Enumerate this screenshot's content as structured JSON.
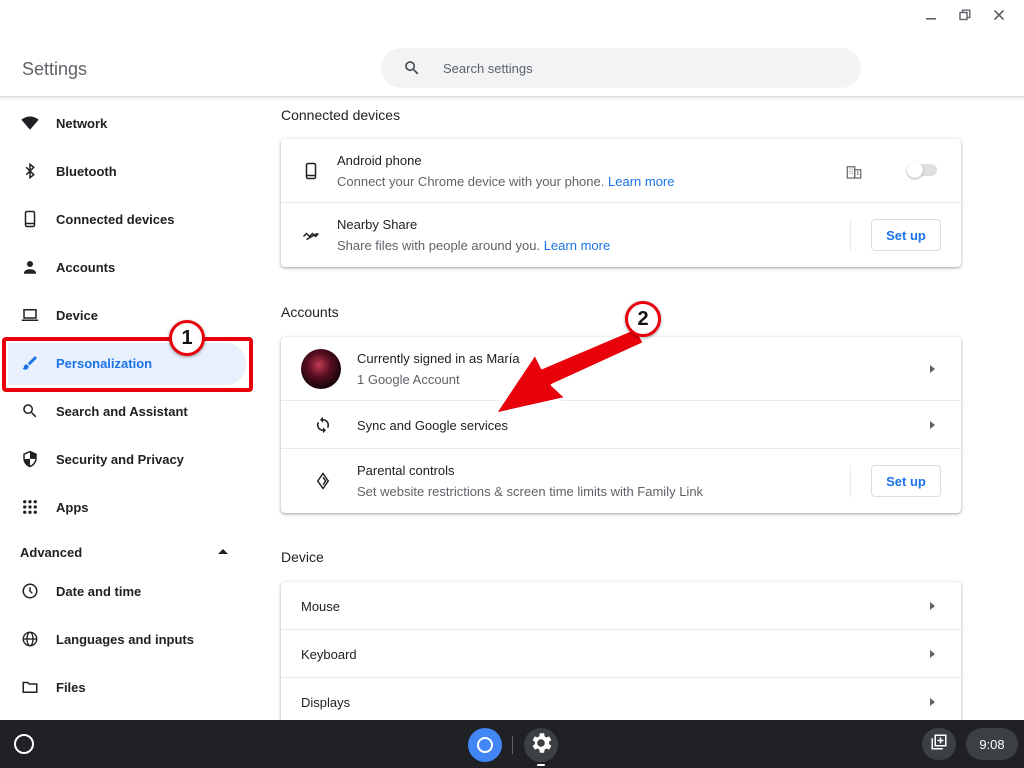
{
  "window": {
    "minimize": "minimize",
    "restore": "restore",
    "close": "close"
  },
  "header": {
    "title": "Settings",
    "search_placeholder": "Search settings"
  },
  "sidebar": {
    "items": [
      {
        "label": "Network",
        "icon": "wifi-icon"
      },
      {
        "label": "Bluetooth",
        "icon": "bluetooth-icon"
      },
      {
        "label": "Connected devices",
        "icon": "phone-icon"
      },
      {
        "label": "Accounts",
        "icon": "person-icon"
      },
      {
        "label": "Device",
        "icon": "laptop-icon"
      },
      {
        "label": "Personalization",
        "icon": "brush-icon",
        "active": true
      },
      {
        "label": "Search and Assistant",
        "icon": "search-icon"
      },
      {
        "label": "Security and Privacy",
        "icon": "shield-icon"
      },
      {
        "label": "Apps",
        "icon": "apps-grid-icon"
      }
    ],
    "advanced_label": "Advanced",
    "advanced_items": [
      {
        "label": "Date and time",
        "icon": "clock-icon"
      },
      {
        "label": "Languages and inputs",
        "icon": "globe-icon"
      },
      {
        "label": "Files",
        "icon": "folder-icon"
      }
    ]
  },
  "annotations": {
    "badge1": "1",
    "badge2": "2",
    "accent": "#e8000b"
  },
  "connected_devices": {
    "title": "Connected devices",
    "android": {
      "title": "Android phone",
      "subtitle": "Connect your Chrome device with your phone.",
      "link": "Learn more"
    },
    "nearby": {
      "title": "Nearby Share",
      "subtitle": "Share files with people around you.",
      "link": "Learn more",
      "button": "Set up"
    }
  },
  "accounts": {
    "title": "Accounts",
    "signed_in": {
      "title": "Currently signed in as María",
      "subtitle": "1 Google Account"
    },
    "sync": {
      "title": "Sync and Google services"
    },
    "parental": {
      "title": "Parental controls",
      "subtitle": "Set website restrictions & screen time limits with Family Link",
      "button": "Set up"
    }
  },
  "device": {
    "title": "Device",
    "items": [
      "Mouse",
      "Keyboard",
      "Displays"
    ]
  },
  "shelf": {
    "time": "9:08"
  },
  "colors": {
    "accent": "#1a73e8",
    "active_bg": "#e8f0fe",
    "shelf": "#202124"
  }
}
